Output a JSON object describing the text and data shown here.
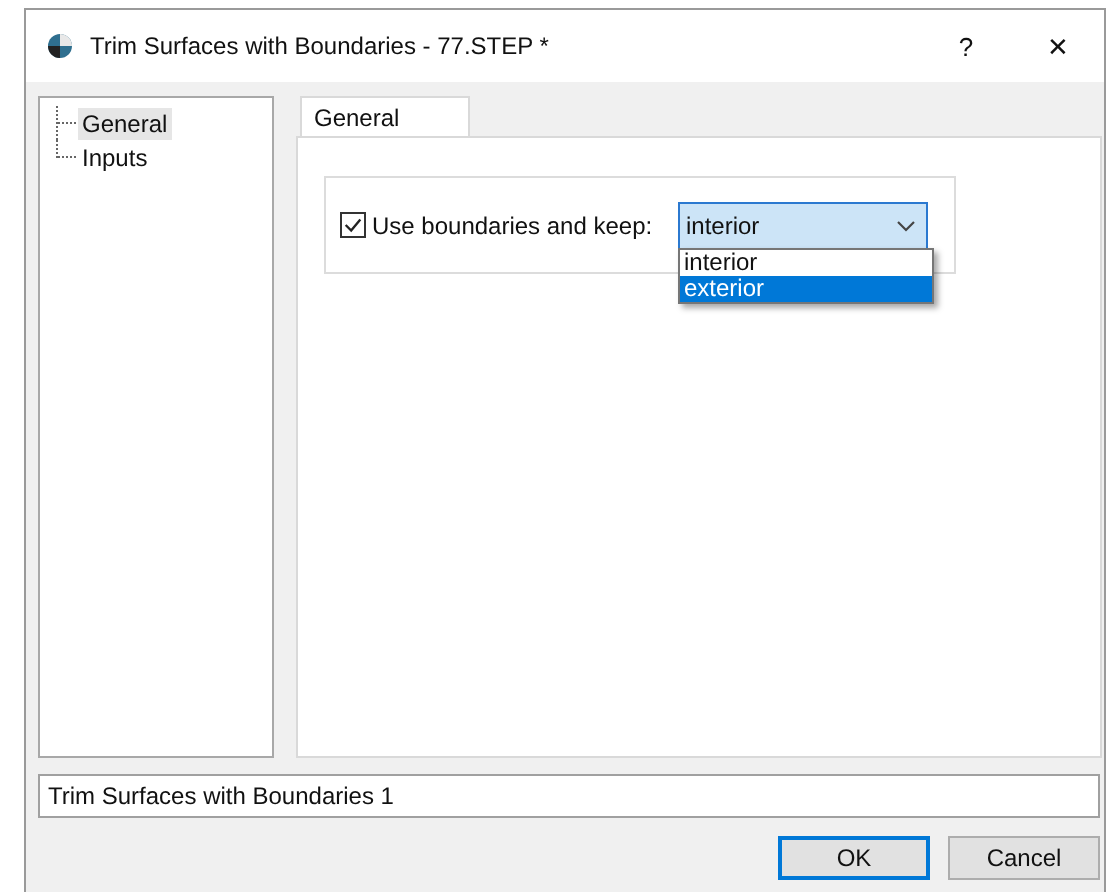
{
  "window": {
    "title": "Trim Surfaces with Boundaries - 77.STEP *",
    "help": "?",
    "close": "✕"
  },
  "tree": {
    "items": [
      {
        "label": "General",
        "selected": true
      },
      {
        "label": "Inputs",
        "selected": false
      }
    ]
  },
  "tabs": [
    {
      "label": "General",
      "selected": true
    }
  ],
  "option": {
    "label": "Use boundaries and keep:",
    "checked": true,
    "value": "interior",
    "dropdown": [
      {
        "label": "interior",
        "highlighted": false
      },
      {
        "label": "exterior",
        "highlighted": true
      }
    ]
  },
  "name_field": {
    "value": "Trim Surfaces with Boundaries 1"
  },
  "buttons": [
    {
      "label": "OK",
      "default": true
    },
    {
      "label": "Cancel",
      "default": false
    }
  ]
}
